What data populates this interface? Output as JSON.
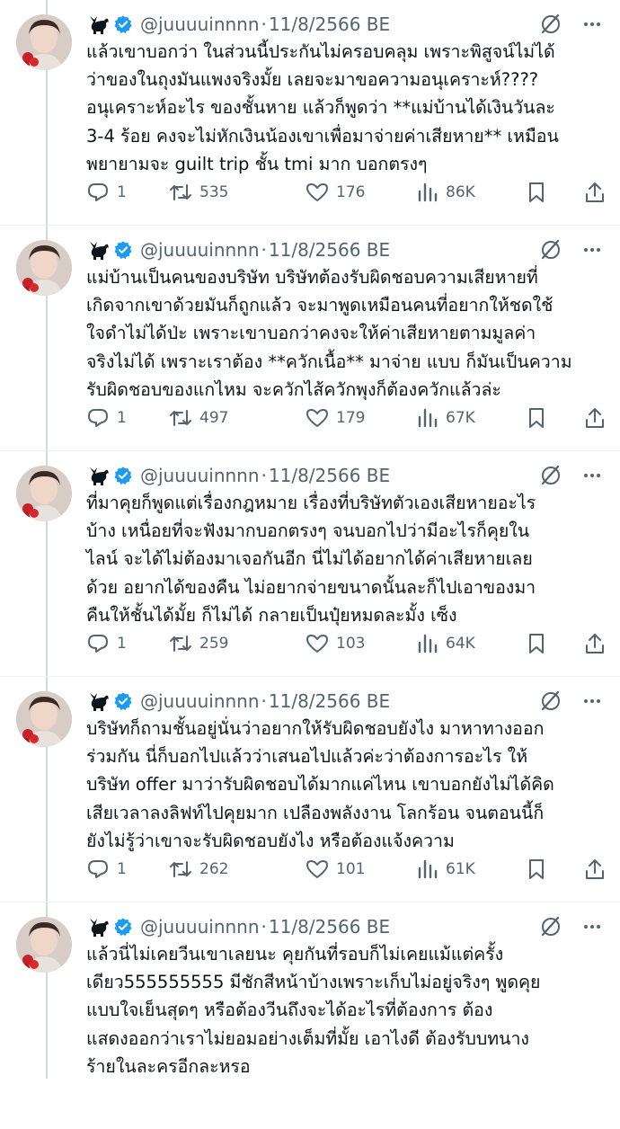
{
  "colors": {
    "verified": "#1d9bf0",
    "secondary_text": "#536471",
    "thread_line": "#cfd9de"
  },
  "tweets": [
    {
      "handle": "@juuuuinnnn",
      "separator": "·",
      "date": "11/8/2566 BE",
      "text": "แล้วเขาบอกว่า ในส่วนนี้ประกันไม่ครอบคลุม เพราะพิสูจน์ไม่ได้\nว่าของในถุงมันแพงจริงมั้ย เลยจะมาขอความอนุเคราะห์????\nอนุเคราะห์อะไร ของชั้นหาย แล้วก็พูดว่า **แม่บ้านได้เงินวันละ\n3-4 ร้อย คงจะไม่หักเงินน้องเขาเพื่อมาจ่ายค่าเสียหาย** เหมือน\nพยายามจะ guilt trip ชั้น tmi มาก บอกตรงๆ",
      "replies": "1",
      "retweets": "535",
      "likes": "176",
      "views": "86K"
    },
    {
      "handle": "@juuuuinnnn",
      "separator": "·",
      "date": "11/8/2566 BE",
      "text": "แม่บ้านเป็นคนของบริษัท บริษัทต้องรับผิดชอบความเสียหายที่\nเกิดจากเขาด้วยมันก็ถูกแล้ว จะมาพูดเหมือนคนที่อยากให้ชดใช้\nใจดำไม่ได้ป่ะ เพราะเขาบอกว่าคงจะให้ค่าเสียหายตามมูลค่า\nจริงไม่ได้ เพราะเราต้อง **ควักเนื้อ** มาจ่าย แบบ ก็มันเป็นความ\nรับผิดชอบของแกไหม จะควักไส้ควักพุงก็ต้องควักแล้วล่ะ",
      "replies": "1",
      "retweets": "497",
      "likes": "179",
      "views": "67K"
    },
    {
      "handle": "@juuuuinnnn",
      "separator": "·",
      "date": "11/8/2566 BE",
      "text": "ที่มาคุยก็พูดแต่เรื่องกฎหมาย เรื่องที่บริษัทตัวเองเสียหายอะไร\nบ้าง เหนื่อยที่จะฟังมากบอกตรงๆ จนบอกไปว่ามีอะไรก็คุยใน\nไลน์ จะได้ไม่ต้องมาเจอกันอีก นี่ไม่ได้อยากได้ค่าเสียหายเลย\nด้วย อยากได้ของคืน ไม่อยากจ่ายขนาดนั้นละก็ไปเอาของมา\nคืนให้ชั้นได้มั้ย ก็ไม่ได้ กลายเป็นปุ๋ยหมดละมั้ง เซ็ง",
      "replies": "1",
      "retweets": "259",
      "likes": "103",
      "views": "64K"
    },
    {
      "handle": "@juuuuinnnn",
      "separator": "·",
      "date": "11/8/2566 BE",
      "text": "บริษัทก็ถามชั้นอยู่นั่นว่าอยากให้รับผิดชอบยังไง มาหาทางออก\nร่วมกัน นี่ก็บอกไปแล้วว่าเสนอไปแล้วค่ะว่าต้องการอะไร ให้\nบริษัท offer มาว่ารับผิดชอบได้มากแค่ไหน เขาบอกยังไม่ได้คิด\nเสียเวลาลงลิฟท์ไปคุยมาก เปลืองพลังงาน โลกร้อน จนตอนนี้ก็\nยังไม่รู้ว่าเขาจะรับผิดชอบยังไง หรือต้องแจ้งความ",
      "replies": "1",
      "retweets": "262",
      "likes": "101",
      "views": "61K"
    },
    {
      "handle": "@juuuuinnnn",
      "separator": "·",
      "date": "11/8/2566 BE",
      "text": "แล้วนี่ไม่เคยวีนเขาเลยนะ คุยกันที่รอบก็ไม่เคยแม้แต่ครั้ง\nเดียว555555555 มีชักสีหน้าบ้างเพราะเก็บไม่อยู่จริงๆ พูดคุย\nแบบใจเย็นสุดๆ หรือต้องวีนถึงจะได้อะไรที่ต้องการ ต้อง\nแสดงออกว่าเราไม่ยอมอย่างเต็มที่มั้ย เอาไงดี ต้องรับบทนาง\nร้ายในละครอีกละหรอ"
    }
  ]
}
